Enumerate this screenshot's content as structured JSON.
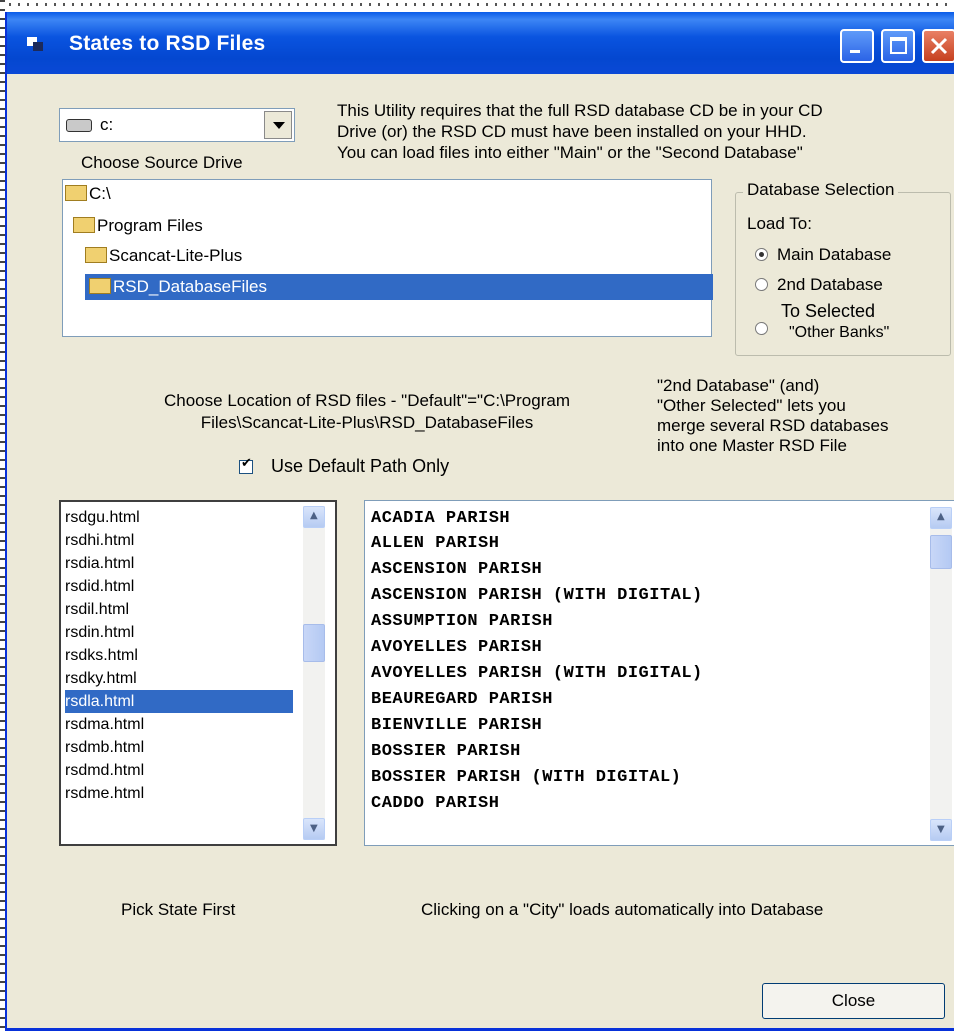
{
  "window": {
    "title": "States to RSD Files"
  },
  "drive": {
    "selected": "c:",
    "label": "Choose Source Drive"
  },
  "info": {
    "line1": "This Utility requires that the full RSD database CD be in your CD",
    "line2": "Drive (or) the RSD CD must have been installed on your HHD.",
    "line3": "You can load files into either \"Main\" or the \"Second Database\""
  },
  "directories": [
    "C:\\",
    "Program Files",
    "Scancat-Lite-Plus",
    "RSD_DatabaseFiles"
  ],
  "database_selection": {
    "title": "Database Selection",
    "load_to": "Load To:",
    "options": [
      "Main Database",
      "2nd Database",
      "To Selected",
      "\"Other Banks\""
    ],
    "selected": "Main Database"
  },
  "location": {
    "line1": "Choose Location of RSD files - \"Default\"=\"C:\\Program",
    "line2": "Files\\Scancat-Lite-Plus\\RSD_DatabaseFiles",
    "checkbox_label": "Use Default Path Only",
    "checkbox_checked": true
  },
  "note": {
    "line1": "\"2nd Database\" (and)",
    "line2": "\"Other Selected\" lets you",
    "line3": "merge several RSD databases",
    "line4": "into one Master RSD File"
  },
  "state_files": [
    "rsdgu.html",
    "rsdhi.html",
    "rsdia.html",
    "rsdid.html",
    "rsdil.html",
    "rsdin.html",
    "rsdks.html",
    "rsdky.html",
    "rsdla.html",
    "rsdma.html",
    "rsdmb.html",
    "rsdmd.html",
    "rsdme.html"
  ],
  "state_selected": "rsdla.html",
  "cities": [
    "ACADIA PARISH",
    "ALLEN PARISH",
    "ASCENSION PARISH",
    "ASCENSION PARISH (WITH DIGITAL)",
    "ASSUMPTION PARISH",
    "AVOYELLES PARISH",
    "AVOYELLES PARISH (WITH DIGITAL)",
    "BEAUREGARD PARISH",
    "BIENVILLE PARISH",
    "BOSSIER PARISH",
    "BOSSIER PARISH (WITH DIGITAL)",
    "CADDO PARISH"
  ],
  "footer": {
    "pick_label": "Pick State First",
    "click_label": "Clicking on a \"City\" loads automatically into Database",
    "close_label": "Close"
  }
}
